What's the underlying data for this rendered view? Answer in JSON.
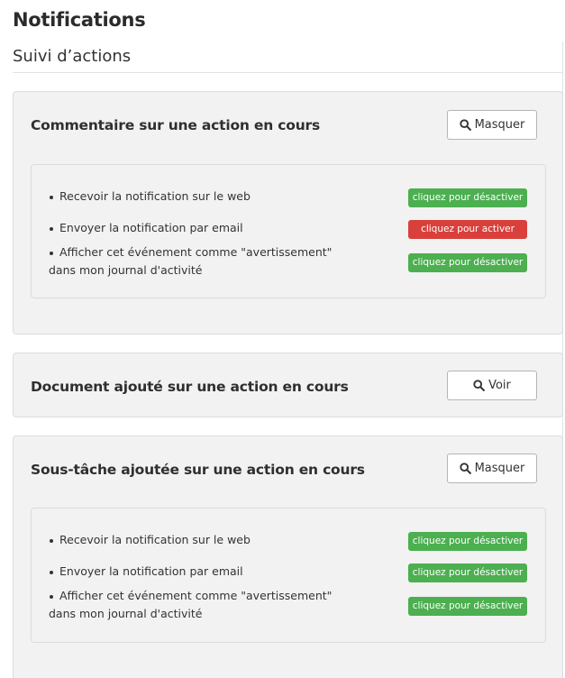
{
  "page_title": "Notifications",
  "section_title": "Suivi d’actions",
  "colors": {
    "active_green": "#4caf50",
    "inactive_red": "#d9403c",
    "panel_bg": "#f2f2f2"
  },
  "panels": [
    {
      "title": "Commentaire sur une action en cours",
      "button": {
        "label": "Masquer",
        "icon": "search-icon"
      },
      "rows": [
        {
          "label": "Recevoir la notification sur le web",
          "toggle": "cliquez pour désactiver",
          "state": "on"
        },
        {
          "label": "Envoyer la notification par email",
          "toggle": "cliquez pour activer",
          "state": "off"
        },
        {
          "label": "Afficher cet événement comme \"avertissement\" dans mon journal d'activité",
          "toggle": "cliquez pour désactiver",
          "state": "on"
        }
      ]
    },
    {
      "title": "Document ajouté sur une action en cours",
      "button": {
        "label": "Voir",
        "icon": "search-icon"
      },
      "rows": []
    },
    {
      "title": "Sous-tâche ajoutée sur une action en cours",
      "button": {
        "label": "Masquer",
        "icon": "search-icon"
      },
      "rows": [
        {
          "label": "Recevoir la notification sur le web",
          "toggle": "cliquez pour désactiver",
          "state": "on"
        },
        {
          "label": "Envoyer la notification par email",
          "toggle": "cliquez pour désactiver",
          "state": "on"
        },
        {
          "label": "Afficher cet événement comme \"avertissement\" dans mon journal d'activité",
          "toggle": "cliquez pour désactiver",
          "state": "on"
        }
      ]
    }
  ]
}
